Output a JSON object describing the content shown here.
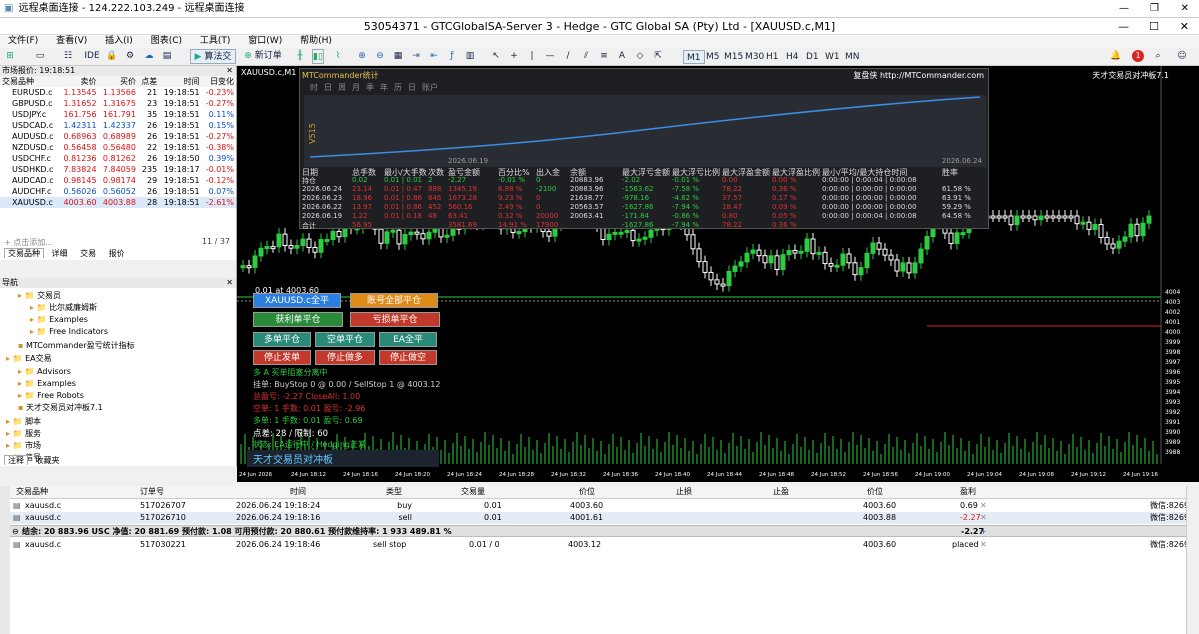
{
  "rdp": {
    "title": "远程桌面连接 - 124.222.103.249 - 远程桌面连接"
  },
  "window": {
    "title": "53054371 - GTCGlobalSA-Server 3 - Hedge - GTC Global SA (Pty) Ltd - [XAUUSD.c,M1]"
  },
  "menu": [
    "文件(F)",
    "查看(V)",
    "插入(I)",
    "图表(C)",
    "工具(T)",
    "窗口(W)",
    "帮助(H)"
  ],
  "toolbar": {
    "ide": "IDE",
    "algo": "算法交易",
    "new_order": "新订单",
    "timeframes": [
      "M1",
      "M5",
      "M15",
      "M30",
      "H1",
      "H4",
      "D1",
      "W1",
      "MN"
    ],
    "notif": "1"
  },
  "market": {
    "title": "市场报价: 19:18:51",
    "headers": [
      "交易品种",
      "卖价",
      "买价",
      "点差",
      "时间",
      "日变化"
    ],
    "rows": [
      [
        "EURUSD.c",
        "1.13545",
        "1.13566",
        "21",
        "19:18:51",
        "-0.23%"
      ],
      [
        "GBPUSD.c",
        "1.31652",
        "1.31675",
        "23",
        "19:18:51",
        "-0.27%"
      ],
      [
        "USDJPY.c",
        "161.756",
        "161.791",
        "35",
        "19:18:51",
        "0.11%"
      ],
      [
        "USDCAD.c",
        "1.42311",
        "1.42337",
        "26",
        "19:18:51",
        "0.15%"
      ],
      [
        "AUDUSD.c",
        "0.68963",
        "0.68989",
        "26",
        "19:18:51",
        "-0.27%"
      ],
      [
        "NZDUSD.c",
        "0.56458",
        "0.56480",
        "22",
        "19:18:51",
        "-0.38%"
      ],
      [
        "USDCHF.c",
        "0.81236",
        "0.81262",
        "26",
        "19:18:50",
        "0.39%"
      ],
      [
        "USDHKD.c",
        "7.83824",
        "7.84059",
        "235",
        "19:18:17",
        "-0.01%"
      ],
      [
        "AUDCAD.c",
        "0.98145",
        "0.98174",
        "29",
        "19:18:51",
        "-0.12%"
      ],
      [
        "AUDCHF.c",
        "0.56026",
        "0.56052",
        "26",
        "19:18:51",
        "0.07%"
      ],
      [
        "XAUUSD.c",
        "4003.60",
        "4003.88",
        "28",
        "19:18:51",
        "-2.61%"
      ]
    ],
    "add": "+ 点击添加...",
    "count": "11 / 37",
    "tabs": [
      "交易品种",
      "详细",
      "交易",
      "报价"
    ]
  },
  "navigator": {
    "title": "导航",
    "items": [
      "交易员",
      "比尔威廉姆斯",
      "Examples",
      "Free Indicators",
      "MTCommander盈亏统计指标",
      "EA交易",
      "Advisors",
      "Examples",
      "Free Robots",
      "天才交易员对冲板7.1",
      "脚本",
      "服务",
      "市场",
      "信号"
    ],
    "tabs": [
      "注释",
      "收藏夹"
    ]
  },
  "chart": {
    "symbol": "XAUUSD.c,M1",
    "right_label": "天才交易员对冲板7.1",
    "price_line": "0.01 at 4003.60",
    "y_ticks": [
      "4004",
      "4003",
      "4002",
      "4001",
      "4000",
      "3999",
      "3998",
      "3997",
      "3996",
      "3995",
      "3994",
      "3993",
      "3992",
      "3991",
      "3990",
      "3989",
      "3988"
    ],
    "x_ticks": [
      "24 Jun 2026",
      "24 Jun 18:12",
      "24 Jun 18:16",
      "24 Jun 18:20",
      "24 Jun 18:24",
      "24 Jun 18:28",
      "24 Jun 18:32",
      "24 Jun 18:36",
      "24 Jun 18:40",
      "24 Jun 18:44",
      "24 Jun 18:48",
      "24 Jun 18:52",
      "24 Jun 18:56",
      "24 Jun 19:00",
      "24 Jun 19:04",
      "24 Jun 19:08",
      "24 Jun 19:12",
      "24 Jun 19:16"
    ]
  },
  "stats": {
    "title": "MTCommander统计",
    "link": "复盘侠 http://MTCommander.com",
    "periods": [
      "时",
      "日",
      "周",
      "月",
      "季",
      "年",
      "历",
      "日",
      "账户"
    ],
    "y_label": "V515",
    "date_from": "2026.06.19",
    "date_to": "2026.06.24",
    "headers": [
      "日期",
      "总手数",
      "最小/大手数",
      "次数",
      "盈亏金额",
      "百分比%",
      "出入金",
      "余额",
      "最大浮亏金额",
      "最大浮亏比例",
      "最大浮盈金额",
      "最大浮盈比例",
      "最小/平均/最大持仓时间",
      "胜率"
    ],
    "rows": [
      [
        "持仓",
        "0.02",
        "0.01 | 0.01",
        "2",
        "-2.27",
        "-0.01 %",
        "0",
        "20883.96",
        "-2.02",
        "-0.01 %",
        "0.00",
        "0.00 %",
        "0:00:00 | 0:00:04 | 0:00:08",
        ""
      ],
      [
        "2026.06.24",
        "23.14",
        "0.01 | 0.47",
        "888",
        "1345.19",
        "6.88 %",
        "-2100",
        "20883.96",
        "-1563.62",
        "-7.58 %",
        "78.22",
        "0.36 %",
        "0:00:00 | 0:00:00 | 0:00:00",
        "61.58 %"
      ],
      [
        "2026.06.23",
        "18.96",
        "0.01 | 0.86",
        "846",
        "1673.28",
        "9.23 %",
        "0",
        "21638.77",
        "-978.16",
        "-4.62 %",
        "37.57",
        "0.17 %",
        "0:00:00 | 0:00:00 | 0:00:00",
        "63.91 %"
      ],
      [
        "2026.06.22",
        "13.97",
        "0.01 | 0.86",
        "452",
        "560.16",
        "2.49 %",
        "0",
        "20563.57",
        "-1627.86",
        "-7.94 %",
        "18.47",
        "0.09 %",
        "0:00:00 | 0:00:00 | 0:00:00",
        "59.29 %"
      ],
      [
        "2026.06.19",
        "1.22",
        "0.01 | 0.18",
        "48",
        "63.41",
        "0.32 %",
        "20000",
        "20063.41",
        "-171.84",
        "-0.86 %",
        "0.80",
        "0.05 %",
        "0:00:00 | 0:00:04 | 0:00:08",
        "64.58 %"
      ],
      [
        "合计",
        "56.95",
        "",
        "",
        "3581.69",
        "14.91 %",
        "17900",
        "",
        "-1627.86",
        "-7.94 %",
        "78.22",
        "0.36 %",
        "",
        ""
      ]
    ]
  },
  "panel": {
    "buttons": [
      "XAUUSD.c全平",
      "账号全部平仓",
      "获利单平仓",
      "亏损单平仓",
      "多单平仓",
      "空单平仓",
      "EA全平",
      "停止发单",
      "停止做多",
      "停止做空"
    ],
    "lines": [
      "多 A 买单阻塞分离中",
      "挂单: BuyStop 0 @ 0.00 / SellStop 1 @ 4003.12",
      "总盈亏: -2.27  CloseAll: 1.00",
      "空单: 1  手数: 0.01  盈亏: -2.96",
      "多单: 1  手数: 0.01  盈亏: 0.69",
      "点差: 28 / 限制: 60",
      "状态: EA运行中 / Hedging正常"
    ],
    "footer": "天才交易员对冲板"
  },
  "terminal": {
    "headers": [
      "交易品种",
      "订单号",
      "时间",
      "类型",
      "交易量",
      "价位",
      "止损",
      "止盈",
      "价位",
      "盈利"
    ],
    "rows": [
      {
        "sym": "xauusd.c",
        "id": "517026707",
        "time": "2026.06.24 19:18:24",
        "type": "buy",
        "vol": "0.01",
        "price": "4003.60",
        "sl": "",
        "tp": "",
        "cur": "4003.60",
        "profit": "0.69",
        "comment": "微信:82695"
      },
      {
        "sym": "xauusd.c",
        "id": "517026710",
        "time": "2026.06.24 19:18:16",
        "type": "sell",
        "vol": "0.01",
        "price": "4001.61",
        "sl": "",
        "tp": "",
        "cur": "4003.88",
        "profit": "-2.27",
        "comment": "微信:82695"
      }
    ],
    "summary": "结余: 20 883.96 USC  净值: 20 881.69  预付款: 1.08  可用预付款: 20 880.61  预付款维持率: 1 933 489.81 %",
    "summary_profit": "-2.27",
    "pending": {
      "sym": "xauusd.c",
      "id": "517030221",
      "time": "2026.06.24 19:18:46",
      "type": "sell stop",
      "vol": "0.01 / 0",
      "price": "4003.12",
      "cur": "4003.60",
      "status": "placed",
      "comment": "微信:82695"
    }
  },
  "colors": {
    "bg": "#000000",
    "bull": "#2ecc40",
    "bear": "#ffffff",
    "grid": "#1a1a1a"
  }
}
